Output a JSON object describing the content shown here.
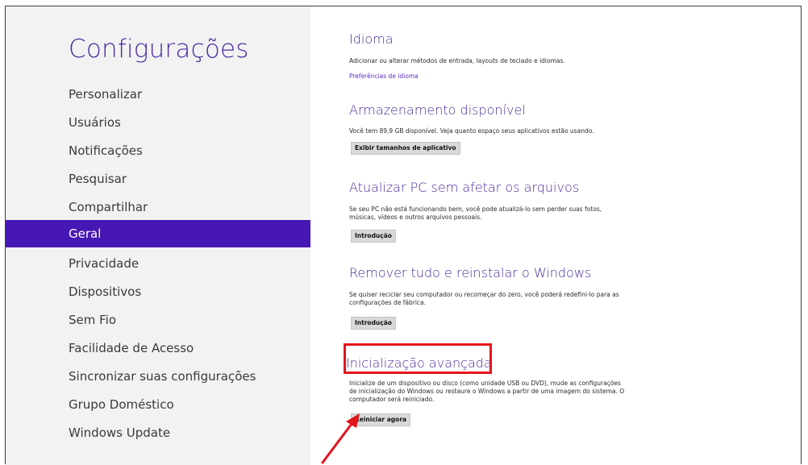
{
  "sidebar": {
    "title": "Configurações",
    "items": [
      {
        "label": "Personalizar"
      },
      {
        "label": "Usuários"
      },
      {
        "label": "Notificações"
      },
      {
        "label": "Pesquisar"
      },
      {
        "label": "Compartilhar"
      },
      {
        "label": "Geral",
        "selected": true
      },
      {
        "label": "Privacidade"
      },
      {
        "label": "Dispositivos"
      },
      {
        "label": "Sem Fio"
      },
      {
        "label": "Facilidade de Acesso"
      },
      {
        "label": "Sincronizar suas configurações"
      },
      {
        "label": "Grupo Doméstico"
      },
      {
        "label": "Windows Update"
      }
    ]
  },
  "sections": {
    "idioma": {
      "title": "Idioma",
      "desc": "Adicionar ou alterar métodos de entrada, layouts de teclado e idiomas.",
      "link": "Preferências de idioma"
    },
    "armazenamento": {
      "title": "Armazenamento disponível",
      "desc": "Você tem 89,9 GB disponível. Veja quanto espaço seus aplicativos estão usando.",
      "button": "Exibir tamanhos de aplicativo"
    },
    "atualizar": {
      "title": "Atualizar PC sem afetar os arquivos",
      "desc": "Se seu PC não está funcionando bem, você pode atualizá-lo sem perder suas fotos, músicas, vídeos e outros arquivos pessoais.",
      "button": "Introdução"
    },
    "remover": {
      "title": "Remover tudo e reinstalar o Windows",
      "desc": "Se quiser reciclar seu computador ou recomeçar do zero, você poderá redefini-lo para as configurações de fábrica.",
      "button": "Introdução"
    },
    "inicializacao": {
      "title": "Inicialização avançada",
      "desc": "Inicialize de um dispositivo ou disco (como unidade USB ou DVD), mude as configurações de inicialização do Windows ou restaure o Windows a partir de uma imagem do sistema. O computador será reiniciado.",
      "button": "Reiniciar agora"
    }
  },
  "colors": {
    "accent": "#4617b4",
    "title_purple": "#4b2a9a",
    "highlight_red": "#e3141c"
  }
}
